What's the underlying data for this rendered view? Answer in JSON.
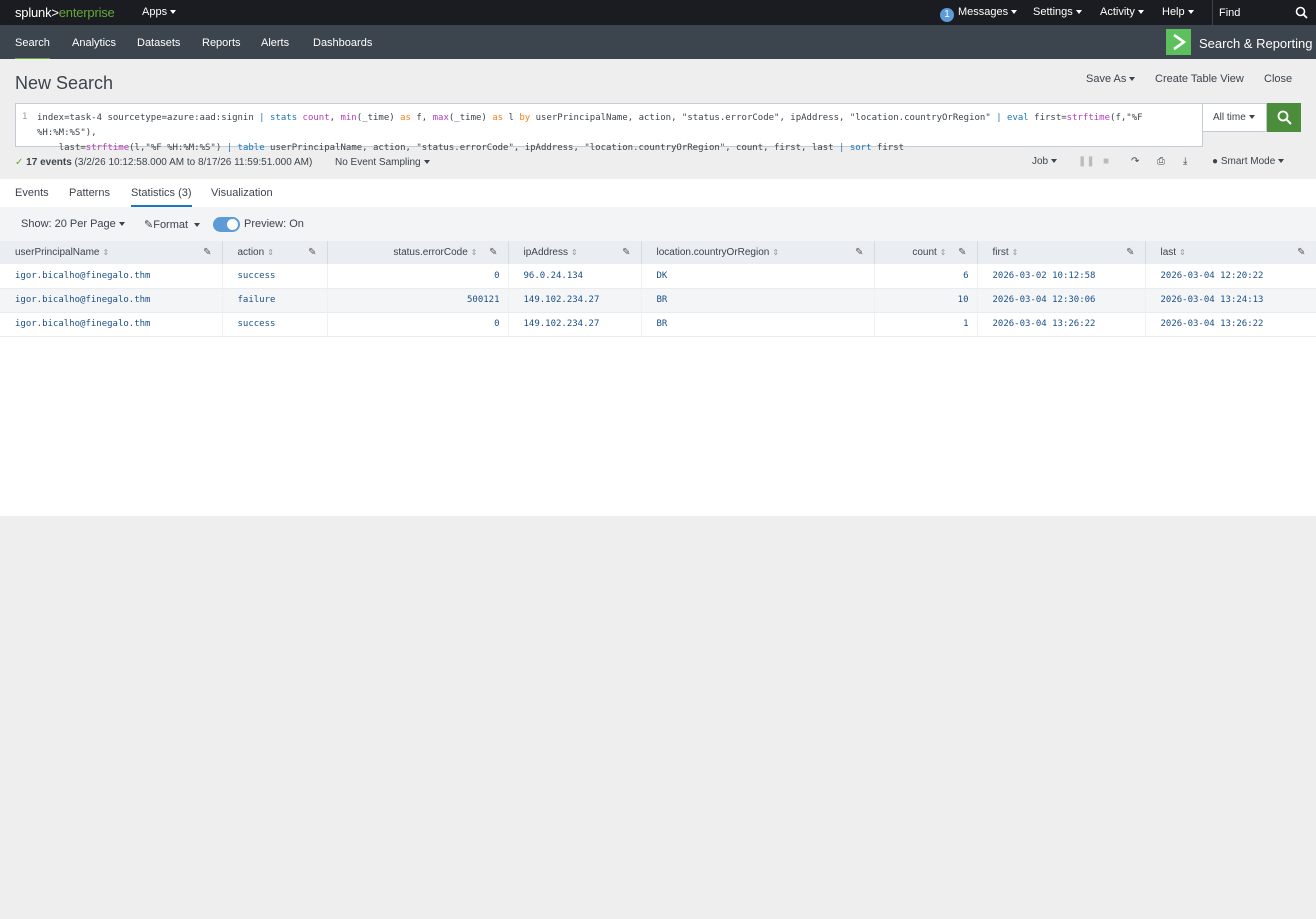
{
  "topbar": {
    "logo_main": "splunk>",
    "logo_suffix": "enterprise",
    "apps": "Apps",
    "messages_count": "1",
    "messages": "Messages",
    "settings": "Settings",
    "activity": "Activity",
    "help": "Help",
    "find_placeholder": "Find"
  },
  "appbar": {
    "nav": [
      "Search",
      "Analytics",
      "Datasets",
      "Reports",
      "Alerts",
      "Dashboards"
    ],
    "app_title": "Search & Reporting"
  },
  "header": {
    "title": "New Search",
    "save_as": "Save As",
    "create_table_view": "Create Table View",
    "close": "Close"
  },
  "search": {
    "line_number": "1",
    "time_range": "All time"
  },
  "status": {
    "events": "17 events",
    "range": "(3/2/26 10:12:58.000 AM to 8/17/26 11:59:51.000 AM)",
    "sampling": "No Event Sampling",
    "job": "Job",
    "mode": "Smart Mode"
  },
  "tabs": [
    "Events",
    "Patterns",
    "Statistics (3)",
    "Visualization"
  ],
  "options": {
    "per_page": "Show: 20 Per Page",
    "format": "Format",
    "preview": "Preview: On"
  },
  "table": {
    "columns": [
      "userPrincipalName",
      "action",
      "status.errorCode",
      "ipAddress",
      "location.countryOrRegion",
      "count",
      "first",
      "last"
    ],
    "rows": [
      [
        "igor.bicalho@finegalo.thm",
        "success",
        "0",
        "96.0.24.134",
        "DK",
        "6",
        "2026-03-02 10:12:58",
        "2026-03-04 12:20:22"
      ],
      [
        "igor.bicalho@finegalo.thm",
        "failure",
        "500121",
        "149.102.234.27",
        "BR",
        "10",
        "2026-03-04 12:30:06",
        "2026-03-04 13:24:13"
      ],
      [
        "igor.bicalho@finegalo.thm",
        "success",
        "0",
        "149.102.234.27",
        "BR",
        "1",
        "2026-03-04 13:26:22",
        "2026-03-04 13:26:22"
      ]
    ]
  },
  "colors": {
    "accent_green": "#65a637",
    "link_blue": "#1a77bd",
    "topbar_bg": "#1a1c21",
    "appbar_bg": "#3c444d"
  }
}
